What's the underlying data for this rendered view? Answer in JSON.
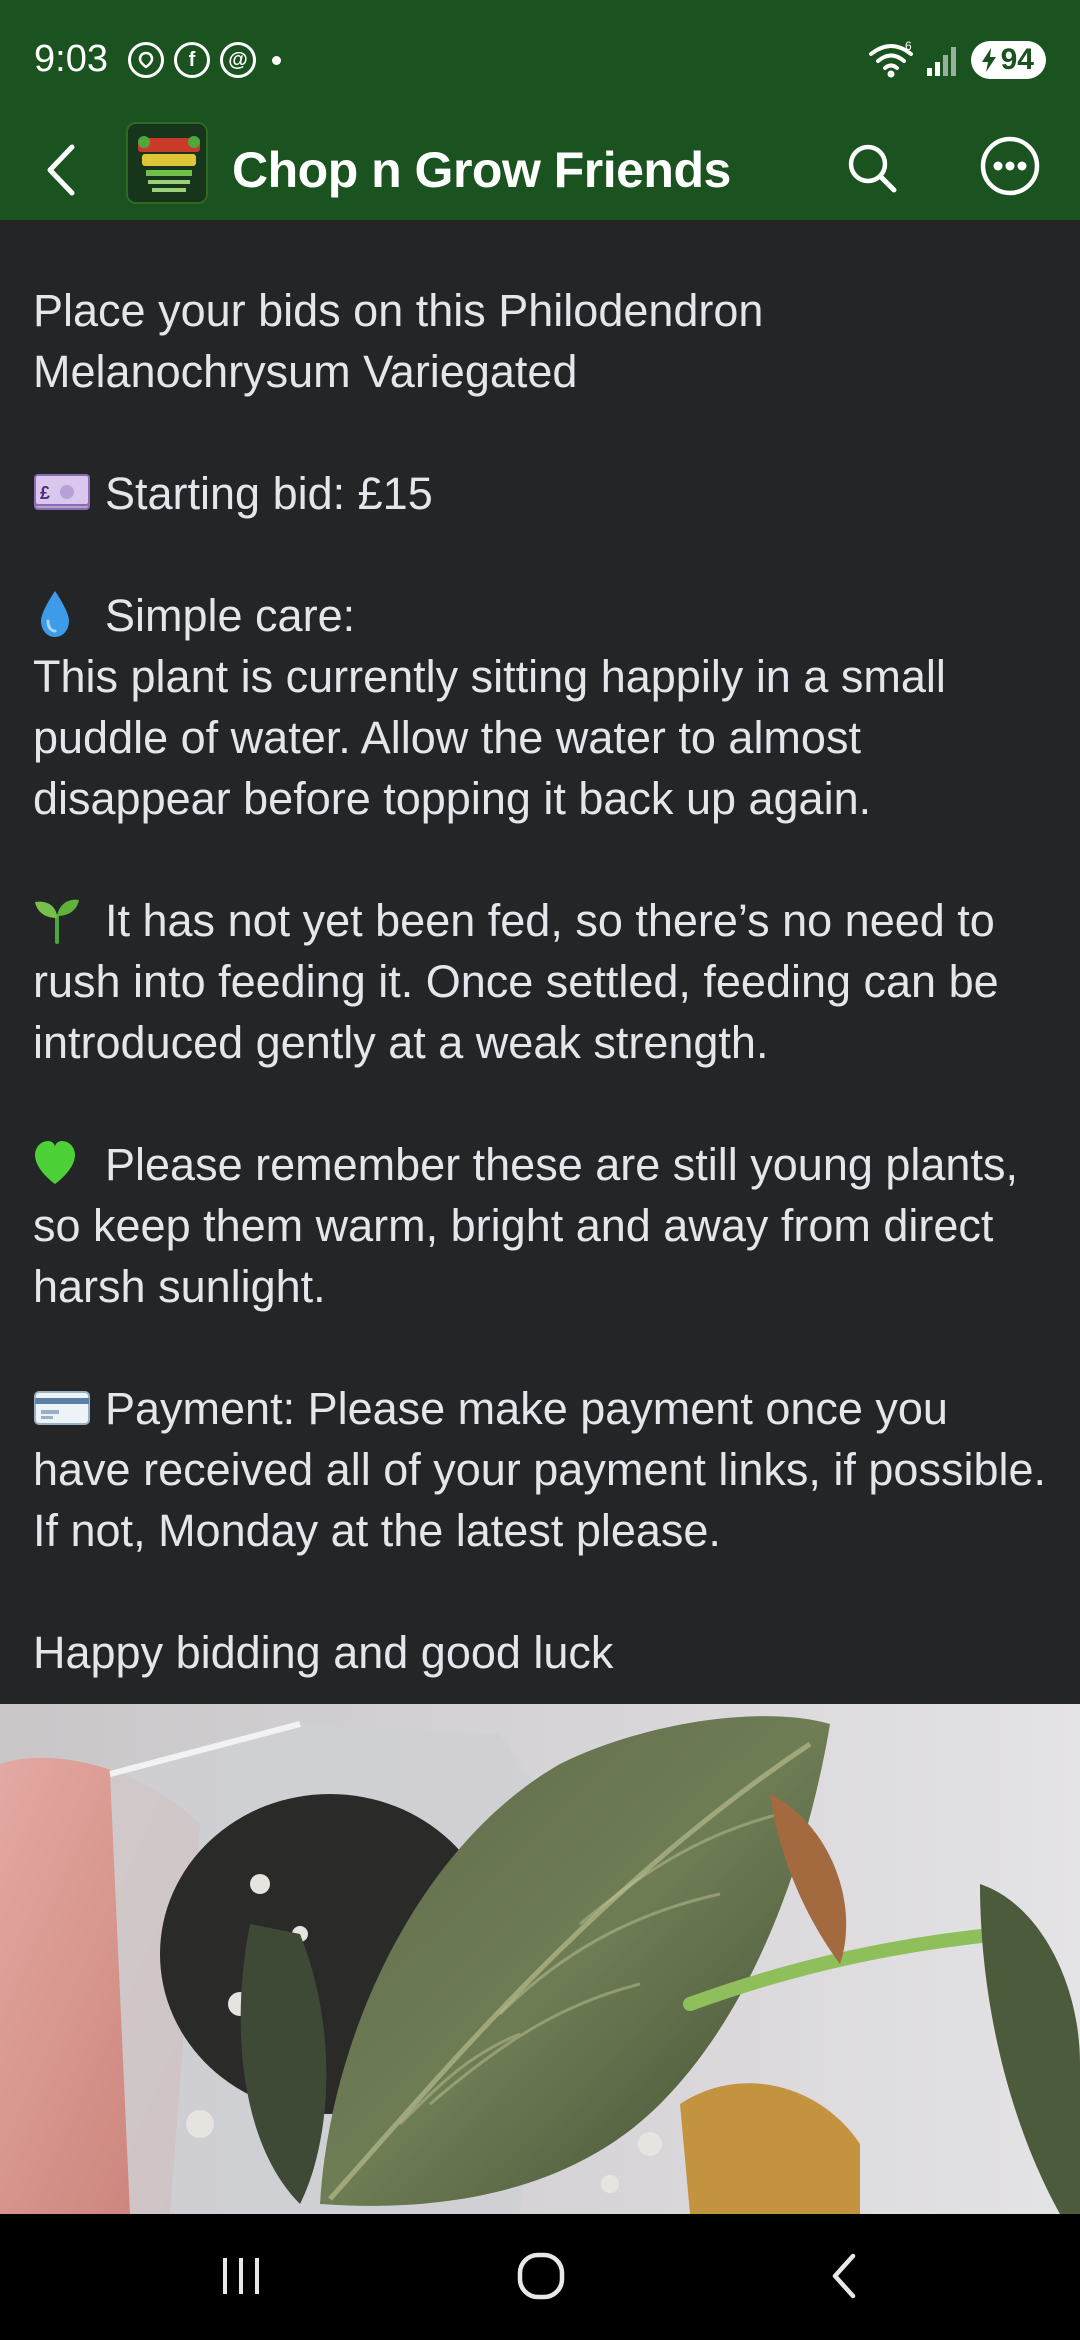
{
  "status_bar": {
    "time": "9:03",
    "battery_level": "94",
    "icons": [
      "location-icon",
      "facebook-icon",
      "threads-icon",
      "wifi-icon",
      "signal-icon",
      "battery-icon"
    ]
  },
  "header": {
    "title": "Chop n Grow Friends",
    "background_color": "#1a5220"
  },
  "post": {
    "intro": "Place your bids on this Philodendron Melanochrysum Variegated",
    "starting_bid": "Starting bid: £15",
    "care_heading": "Simple care:",
    "care_text": "This plant is currently sitting happily in a small puddle of water. Allow the water to almost disappear before topping it back up again.",
    "feeding_text": "It has not yet been fed, so there’s no need to rush into feeding it. Once settled, feeding can be introduced gently at a weak strength.",
    "reminder_text": "Please remember these are still young plants, so keep them warm, bright and away from direct harsh sunlight.",
    "payment_text": "Payment: Please make payment once you have received all of your payment links, if possible. If not, Monday at the latest please.",
    "closing": "Happy bidding and good luck",
    "emojis": [
      "money-emoji",
      "droplet-emoji",
      "seedling-emoji",
      "green-heart-emoji",
      "credit-card-emoji"
    ]
  },
  "nav": {
    "buttons": [
      "recent-apps",
      "home",
      "back"
    ]
  }
}
